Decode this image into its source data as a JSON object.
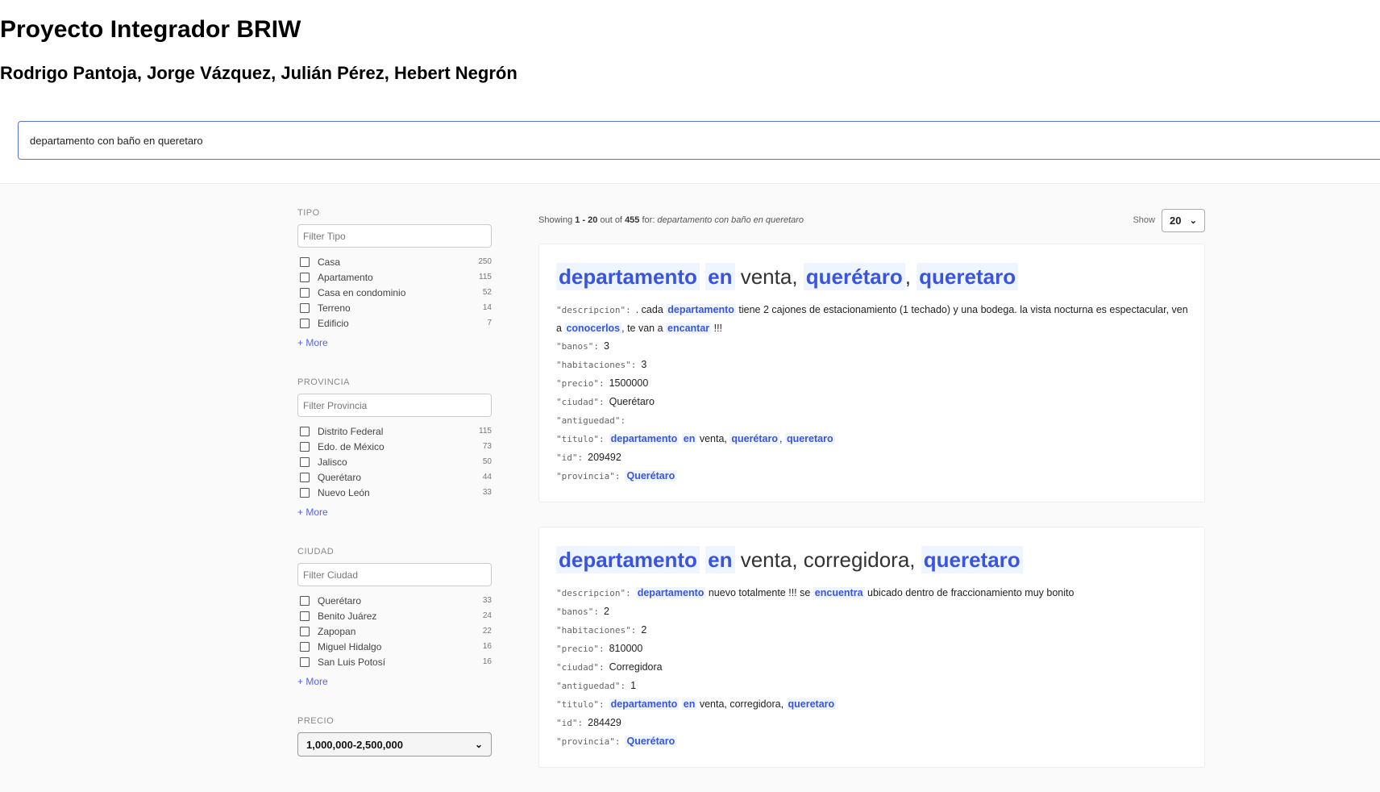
{
  "header": {
    "title": "Proyecto Integrador BRIW",
    "authors": "Rodrigo Pantoja, Jorge Vázquez, Julián Pérez, Hebert Negrón",
    "search_value": "departamento con baño en queretaro"
  },
  "facets": [
    {
      "label": "TIPO",
      "placeholder": "Filter Tipo",
      "options": [
        {
          "label": "Casa",
          "count": "250"
        },
        {
          "label": "Apartamento",
          "count": "115"
        },
        {
          "label": "Casa en condominio",
          "count": "52"
        },
        {
          "label": "Terreno",
          "count": "14"
        },
        {
          "label": "Edificio",
          "count": "7"
        }
      ],
      "more": "+ More"
    },
    {
      "label": "PROVINCIA",
      "placeholder": "Filter Provincia",
      "options": [
        {
          "label": "Distrito Federal",
          "count": "115"
        },
        {
          "label": "Edo. de México",
          "count": "73"
        },
        {
          "label": "Jalisco",
          "count": "50"
        },
        {
          "label": "Querétaro",
          "count": "44"
        },
        {
          "label": "Nuevo León",
          "count": "33"
        }
      ],
      "more": "+ More"
    },
    {
      "label": "CIUDAD",
      "placeholder": "Filter Ciudad",
      "options": [
        {
          "label": "Querétaro",
          "count": "33"
        },
        {
          "label": "Benito Juárez",
          "count": "24"
        },
        {
          "label": "Zapopan",
          "count": "22"
        },
        {
          "label": "Miguel Hidalgo",
          "count": "16"
        },
        {
          "label": "San Luis Potosí",
          "count": "16"
        }
      ],
      "more": "+ More"
    }
  ],
  "precio": {
    "label": "PRECIO",
    "selected": "1,000,000-2,500,000"
  },
  "summary": {
    "prefix": "Showing",
    "range": "1 - 20",
    "mid": "out of",
    "total": "455",
    "for": "for:",
    "query": "departamento con baño en queretaro",
    "show_label": "Show",
    "show_value": "20"
  },
  "results": [
    {
      "title": [
        {
          "t": "departamento",
          "h": true
        },
        {
          "t": " "
        },
        {
          "t": "en",
          "h": true
        },
        {
          "t": " venta, "
        },
        {
          "t": "querétaro",
          "h": true
        },
        {
          "t": ", "
        },
        {
          "t": "queretaro",
          "h": true
        }
      ],
      "fields": [
        {
          "key": "\"descripcion\":",
          "value": [
            {
              "t": ". cada "
            },
            {
              "t": "departamento",
              "h": true
            },
            {
              "t": " tiene 2 cajones de estacionamiento (1 techado) y una bodega. la vista nocturna es espectacular, ven a "
            },
            {
              "t": "conocerlos",
              "h": true
            },
            {
              "t": ", te van a "
            },
            {
              "t": "encantar",
              "h": true
            },
            {
              "t": " !!!"
            }
          ]
        },
        {
          "key": "\"banos\":",
          "value": [
            {
              "t": "3"
            }
          ]
        },
        {
          "key": "\"habitaciones\":",
          "value": [
            {
              "t": "3"
            }
          ]
        },
        {
          "key": "\"precio\":",
          "value": [
            {
              "t": "1500000"
            }
          ]
        },
        {
          "key": "\"ciudad\":",
          "value": [
            {
              "t": "Querétaro"
            }
          ]
        },
        {
          "key": "\"antiguedad\":",
          "value": []
        },
        {
          "key": "\"titulo\":",
          "value": [
            {
              "t": "departamento",
              "h": true
            },
            {
              "t": " "
            },
            {
              "t": "en",
              "h": true
            },
            {
              "t": " venta, "
            },
            {
              "t": "querétaro",
              "h": true
            },
            {
              "t": ", "
            },
            {
              "t": "queretaro",
              "h": true
            }
          ]
        },
        {
          "key": "\"id\":",
          "value": [
            {
              "t": "209492"
            }
          ]
        },
        {
          "key": "\"provincia\":",
          "value": [
            {
              "t": "Querétaro",
              "h": true
            }
          ]
        }
      ]
    },
    {
      "title": [
        {
          "t": "departamento",
          "h": true
        },
        {
          "t": " "
        },
        {
          "t": "en",
          "h": true
        },
        {
          "t": " venta, corregidora, "
        },
        {
          "t": "queretaro",
          "h": true
        }
      ],
      "fields": [
        {
          "key": "\"descripcion\":",
          "value": [
            {
              "t": "departamento",
              "h": true
            },
            {
              "t": " nuevo totalmente !!! se "
            },
            {
              "t": "encuentra",
              "h": true
            },
            {
              "t": " ubicado dentro de fraccionamiento muy bonito"
            }
          ]
        },
        {
          "key": "\"banos\":",
          "value": [
            {
              "t": "2"
            }
          ]
        },
        {
          "key": "\"habitaciones\":",
          "value": [
            {
              "t": "2"
            }
          ]
        },
        {
          "key": "\"precio\":",
          "value": [
            {
              "t": "810000"
            }
          ]
        },
        {
          "key": "\"ciudad\":",
          "value": [
            {
              "t": "Corregidora"
            }
          ]
        },
        {
          "key": "\"antiguedad\":",
          "value": [
            {
              "t": "1"
            }
          ]
        },
        {
          "key": "\"titulo\":",
          "value": [
            {
              "t": "departamento",
              "h": true
            },
            {
              "t": " "
            },
            {
              "t": "en",
              "h": true
            },
            {
              "t": " venta, corregidora, "
            },
            {
              "t": "queretaro",
              "h": true
            }
          ]
        },
        {
          "key": "\"id\":",
          "value": [
            {
              "t": "284429"
            }
          ]
        },
        {
          "key": "\"provincia\":",
          "value": [
            {
              "t": "Querétaro",
              "h": true
            }
          ]
        }
      ]
    }
  ]
}
